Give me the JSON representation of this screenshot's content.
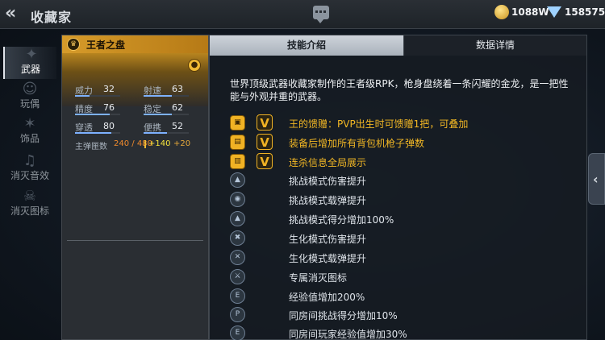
{
  "header": {
    "title": "收藏家",
    "back_icon": "chevron-left-icon",
    "chat_icon": "chat-icon",
    "coins": "1088W",
    "diamonds": "158575"
  },
  "sidebar": {
    "items": [
      {
        "label": "武器",
        "icon": "gun-icon",
        "active": true
      },
      {
        "label": "玩偶",
        "icon": "doll-icon",
        "active": false
      },
      {
        "label": "饰品",
        "icon": "ornament-icon",
        "active": false
      },
      {
        "label": "消灭音效",
        "icon": "sound-icon",
        "active": false
      },
      {
        "label": "消灭图标",
        "icon": "emblem-icon",
        "active": false
      }
    ]
  },
  "weapon": {
    "name": "王者之盘",
    "stats": [
      {
        "label": "威力",
        "value": "32",
        "level": 0.32
      },
      {
        "label": "射速",
        "value": "63",
        "level": 0.63
      },
      {
        "label": "精度",
        "value": "76",
        "level": 0.76
      },
      {
        "label": "稳定",
        "value": "62",
        "level": 0.62
      },
      {
        "label": "穿透",
        "value": "80",
        "level": 0.8
      },
      {
        "label": "便携",
        "value": "52",
        "level": 0.52
      }
    ],
    "ammo_label": "主弹匣数",
    "ammo_value": "240 / 480",
    "ammo_bonus": "+140",
    "ammo_bonus2": "+20"
  },
  "detail": {
    "tabs": [
      {
        "label": "技能介绍",
        "active": true
      },
      {
        "label": "数据详情",
        "active": false
      }
    ],
    "description": "世界顶级武器收藏家制作的王者级RPK，枪身盘绕着一条闪耀的金龙，是一把性能与外观并重的武器。",
    "features": [
      {
        "icon": "gift-icon",
        "badge": "V",
        "text": "王的馈赠：PVP出生时可馈赠1把，可叠加",
        "highlight": true
      },
      {
        "icon": "ammo-crate-icon",
        "badge": "V",
        "text": "装备后增加所有背包机枪子弹数",
        "highlight": true
      },
      {
        "icon": "broadcast-icon",
        "badge": "V",
        "text": "连杀信息全局展示",
        "highlight": true
      },
      {
        "icon": "damage-up-icon",
        "text": "挑战模式伤害提升",
        "highlight": false
      },
      {
        "icon": "ammo-up-icon",
        "text": "挑战模式载弹提升",
        "highlight": false
      },
      {
        "icon": "score-up-icon",
        "text": "挑战模式得分增加100%",
        "highlight": false
      },
      {
        "icon": "zombie-damage-icon",
        "text": "生化模式伤害提升",
        "highlight": false
      },
      {
        "icon": "zombie-ammo-icon",
        "text": "生化模式载弹提升",
        "highlight": false
      },
      {
        "icon": "kill-icon-icon",
        "text": "专属消灭图标",
        "highlight": false
      },
      {
        "icon": "exp-icon",
        "text": "经验值增加200%",
        "highlight": false
      },
      {
        "icon": "room-score-icon",
        "text": "同房间挑战得分增加10%",
        "highlight": false
      },
      {
        "icon": "room-exp-icon",
        "text": "同房间玩家经验值增加30%",
        "highlight": false
      }
    ]
  },
  "colors": {
    "accent_gold": "#f2b724",
    "panel_header": "#d69b2a",
    "tab_active": "#cdd3da"
  }
}
